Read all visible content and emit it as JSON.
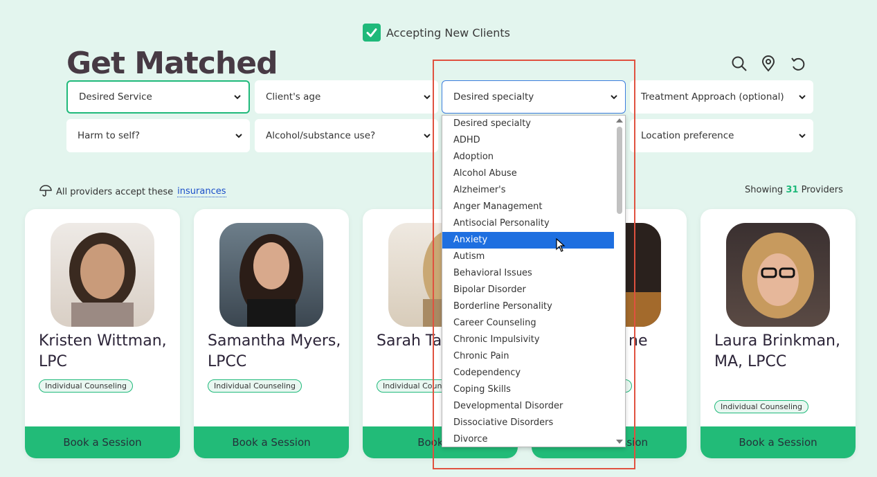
{
  "accepting": {
    "label": "Accepting New Clients",
    "checked": true
  },
  "page_title": "Get Matched",
  "toolbar": {
    "icons": [
      "search-icon",
      "location-pin-icon",
      "reset-icon"
    ]
  },
  "filters": {
    "service": "Desired Service",
    "age": "Client's age",
    "specialty": "Desired specialty",
    "approach": "Treatment Approach (optional)",
    "harm": "Harm to self?",
    "substance": "Alcohol/substance use?",
    "location": "Location preference"
  },
  "insurance": {
    "text": "All providers accept these",
    "link": "insurances"
  },
  "showing": {
    "prefix": "Showing",
    "count": "31",
    "suffix": "Providers"
  },
  "providers": [
    {
      "name": "Kristen Wittman, LPC",
      "tag": "Individual Counseling",
      "button": "Book a Session"
    },
    {
      "name": "Samantha Myers, LPCC",
      "tag": "Individual Counseling",
      "button": "Book a Session"
    },
    {
      "name": "Sarah Ta LPCC",
      "tag": "Individual Coun",
      "button": "Book a S"
    },
    {
      "name": "ne",
      "tag": "g",
      "button": "ssion"
    },
    {
      "name": "Laura Brinkman, MA, LPCC",
      "tag": "Individual Counseling",
      "button": "Book a Session"
    }
  ],
  "specialty_options": [
    "Desired specialty",
    "ADHD",
    "Adoption",
    "Alcohol Abuse",
    "Alzheimer's",
    "Anger Management",
    "Antisocial Personality",
    "Anxiety",
    "Autism",
    "Behavioral Issues",
    "Bipolar Disorder",
    "Borderline Personality",
    "Career Counseling",
    "Chronic Impulsivity",
    "Chronic Pain",
    "Codependency",
    "Coping Skills",
    "Developmental Disorder",
    "Dissociative Disorders",
    "Divorce"
  ],
  "selected_option": "Anxiety",
  "colors": {
    "accent": "#1fb97a",
    "background": "#e3f5ee",
    "highlight": "#e0513f",
    "selection": "#1e6fe0"
  }
}
